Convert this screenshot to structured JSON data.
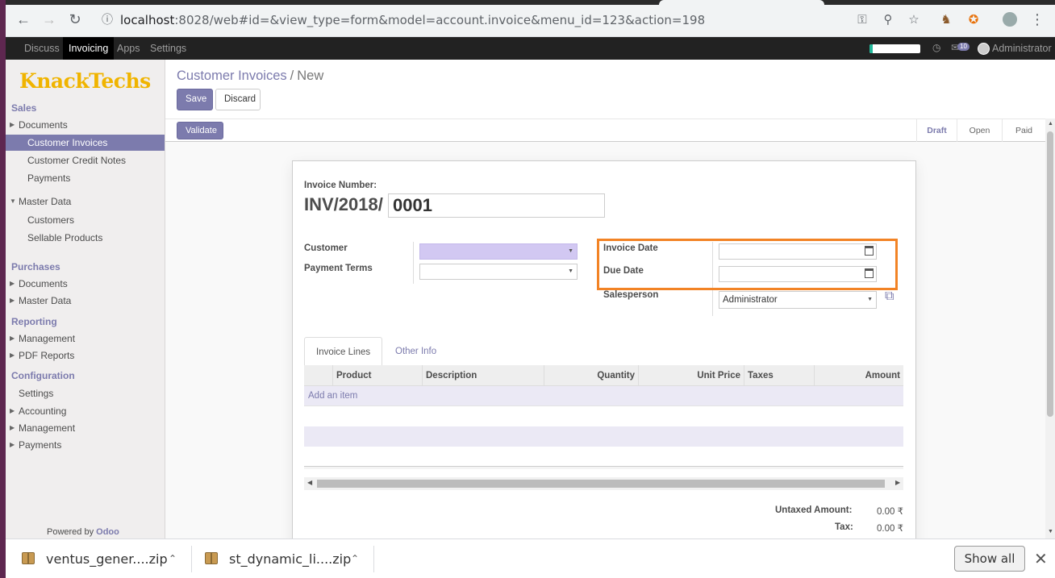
{
  "browser": {
    "url_host": "localhost",
    "url_rest": ":8028/web#id=&view_type=form&model=account.invoice&menu_id=123&action=198"
  },
  "topbar": {
    "menus": [
      "Discuss",
      "Invoicing",
      "Apps",
      "Settings"
    ],
    "active_menu": "Invoicing",
    "chat_count": "10",
    "user": "Administrator"
  },
  "sidebar": {
    "logo": "KnackTechs",
    "sections": {
      "sales": "Sales",
      "purchases": "Purchases",
      "reporting": "Reporting",
      "configuration": "Configuration"
    },
    "items": {
      "sales_documents": "Documents",
      "customer_invoices": "Customer Invoices",
      "customer_credit_notes": "Customer Credit Notes",
      "payments": "Payments",
      "master_data": "Master Data",
      "customers": "Customers",
      "sellable_products": "Sellable Products",
      "purch_documents": "Documents",
      "purch_master_data": "Master Data",
      "rep_management": "Management",
      "pdf_reports": "PDF Reports",
      "settings": "Settings",
      "accounting": "Accounting",
      "conf_management": "Management",
      "conf_payments": "Payments"
    },
    "powered_by": "Powered by",
    "powered_brand": "Odoo"
  },
  "control_panel": {
    "breadcrumb_link": "Customer Invoices",
    "breadcrumb_sep": "/",
    "breadcrumb_current": "New",
    "save_label": "Save",
    "discard_label": "Discard"
  },
  "statusbar": {
    "validate_label": "Validate",
    "steps": [
      "Draft",
      "Open",
      "Paid"
    ],
    "current_step": "Draft"
  },
  "form": {
    "invoice_number_label": "Invoice Number:",
    "invoice_prefix": "INV/2018/",
    "invoice_suffix": "0001",
    "customer_label": "Customer",
    "payment_terms_label": "Payment Terms",
    "invoice_date_label": "Invoice Date",
    "due_date_label": "Due Date",
    "salesperson_label": "Salesperson",
    "salesperson_value": "Administrator"
  },
  "notebook": {
    "tabs": [
      "Invoice Lines",
      "Other Info"
    ],
    "active_tab": "Invoice Lines",
    "columns": [
      "Product",
      "Description",
      "Quantity",
      "Unit Price",
      "Taxes",
      "Amount"
    ],
    "add_item": "Add an item"
  },
  "totals": {
    "untaxed_label": "Untaxed Amount:",
    "untaxed_value": "0.00 ₹",
    "tax_label": "Tax:",
    "tax_value": "0.00 ₹"
  },
  "downloads": {
    "items": [
      "ventus_gener....zip",
      "st_dynamic_li....zip"
    ],
    "show_all": "Show all"
  },
  "colors": {
    "brand": "#7c7bad",
    "highlight": "#f28325",
    "logo": "#f0b400"
  }
}
